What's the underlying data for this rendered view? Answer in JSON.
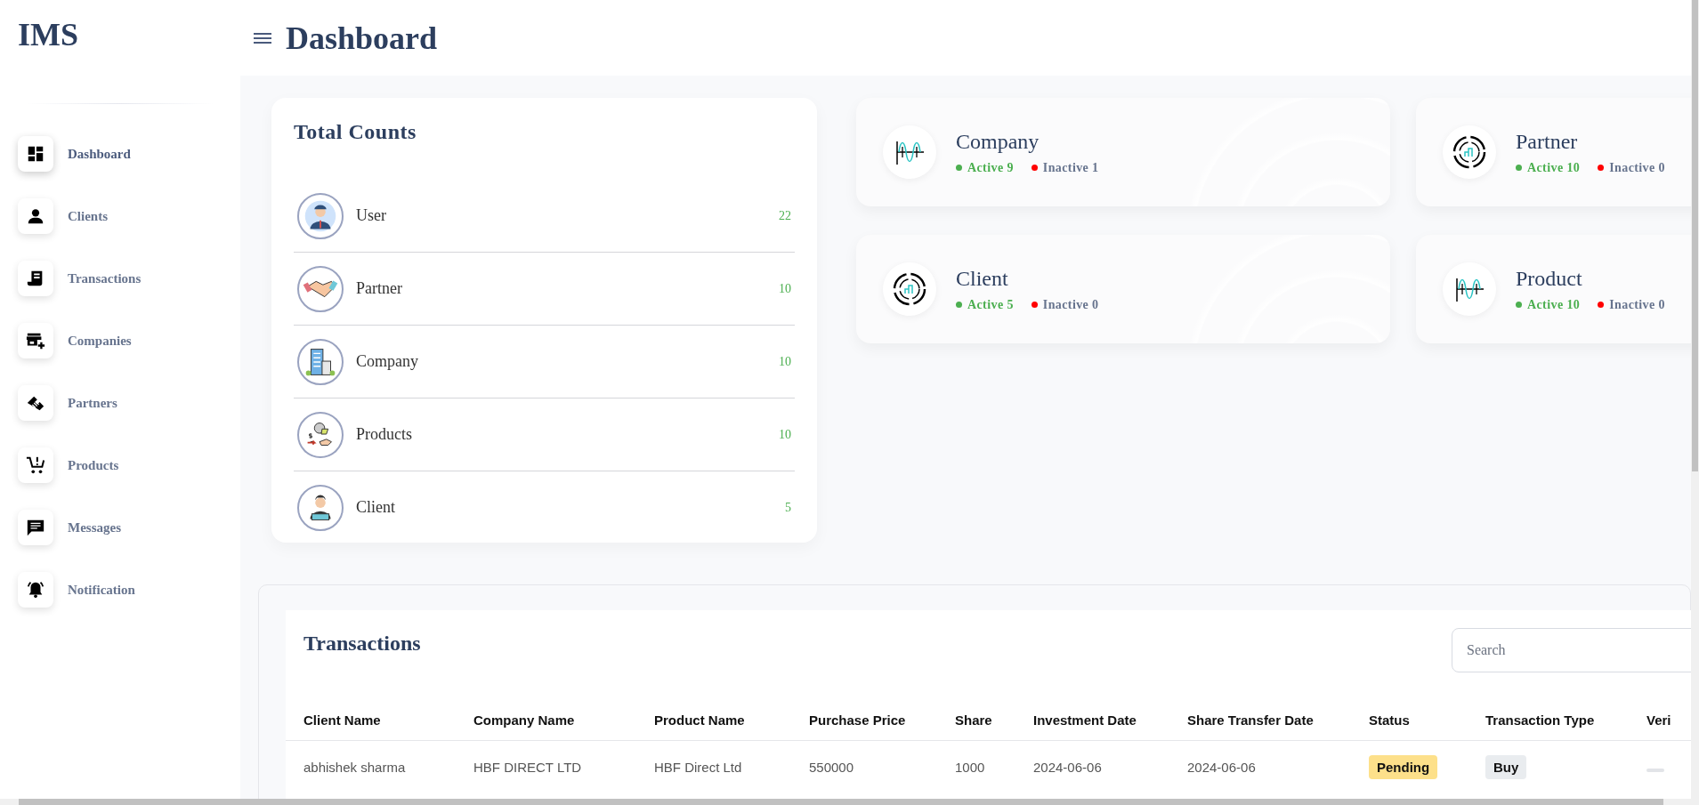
{
  "sidebar": {
    "logo": "IMS",
    "items": [
      {
        "label": "Dashboard",
        "selected": true
      },
      {
        "label": "Clients",
        "selected": false
      },
      {
        "label": "Transactions",
        "selected": false
      },
      {
        "label": "Companies",
        "selected": false
      },
      {
        "label": "Partners",
        "selected": false
      },
      {
        "label": "Products",
        "selected": false
      },
      {
        "label": "Messages",
        "selected": false
      },
      {
        "label": "Notification",
        "selected": false
      }
    ]
  },
  "header": {
    "title": "Dashboard"
  },
  "total_counts": {
    "title": "Total Counts",
    "items": [
      {
        "label": "User",
        "count": "22"
      },
      {
        "label": "Partner",
        "count": "10"
      },
      {
        "label": "Company",
        "count": "10"
      },
      {
        "label": "Products",
        "count": "10"
      },
      {
        "label": "Client",
        "count": "5"
      }
    ]
  },
  "stat_cards": [
    {
      "kind": "wave",
      "title": "Company",
      "active": "Active 9",
      "inactive": "Inactive 1"
    },
    {
      "kind": "ring",
      "title": "Partner",
      "active": "Active 10",
      "inactive": "Inactive 0"
    },
    {
      "kind": "ring",
      "title": "Client",
      "active": "Active 5",
      "inactive": "Inactive 0"
    },
    {
      "kind": "wave",
      "title": "Product",
      "active": "Active 10",
      "inactive": "Inactive 0"
    }
  ],
  "transactions": {
    "title": "Transactions",
    "search": {
      "placeholder": "Search"
    },
    "columns": [
      "Client Name",
      "Company Name",
      "Product Name",
      "Purchase Price",
      "Share",
      "Investment Date",
      "Share Transfer Date",
      "Status",
      "Transaction Type",
      "Veri"
    ],
    "rows": [
      [
        {
          "kind": "text",
          "text": "abhishek sharma"
        },
        {
          "kind": "text",
          "text": "HBF DIRECT LTD"
        },
        {
          "kind": "text",
          "text": "HBF Direct Ltd"
        },
        {
          "kind": "text",
          "text": "550000"
        },
        {
          "kind": "text",
          "text": "1000"
        },
        {
          "kind": "text",
          "text": "2024-06-06"
        },
        {
          "kind": "text",
          "text": "2024-06-06"
        },
        {
          "kind": "status",
          "text": "Pending"
        },
        {
          "kind": "type",
          "text": "Buy"
        },
        {
          "kind": "blank"
        }
      ]
    ]
  }
}
